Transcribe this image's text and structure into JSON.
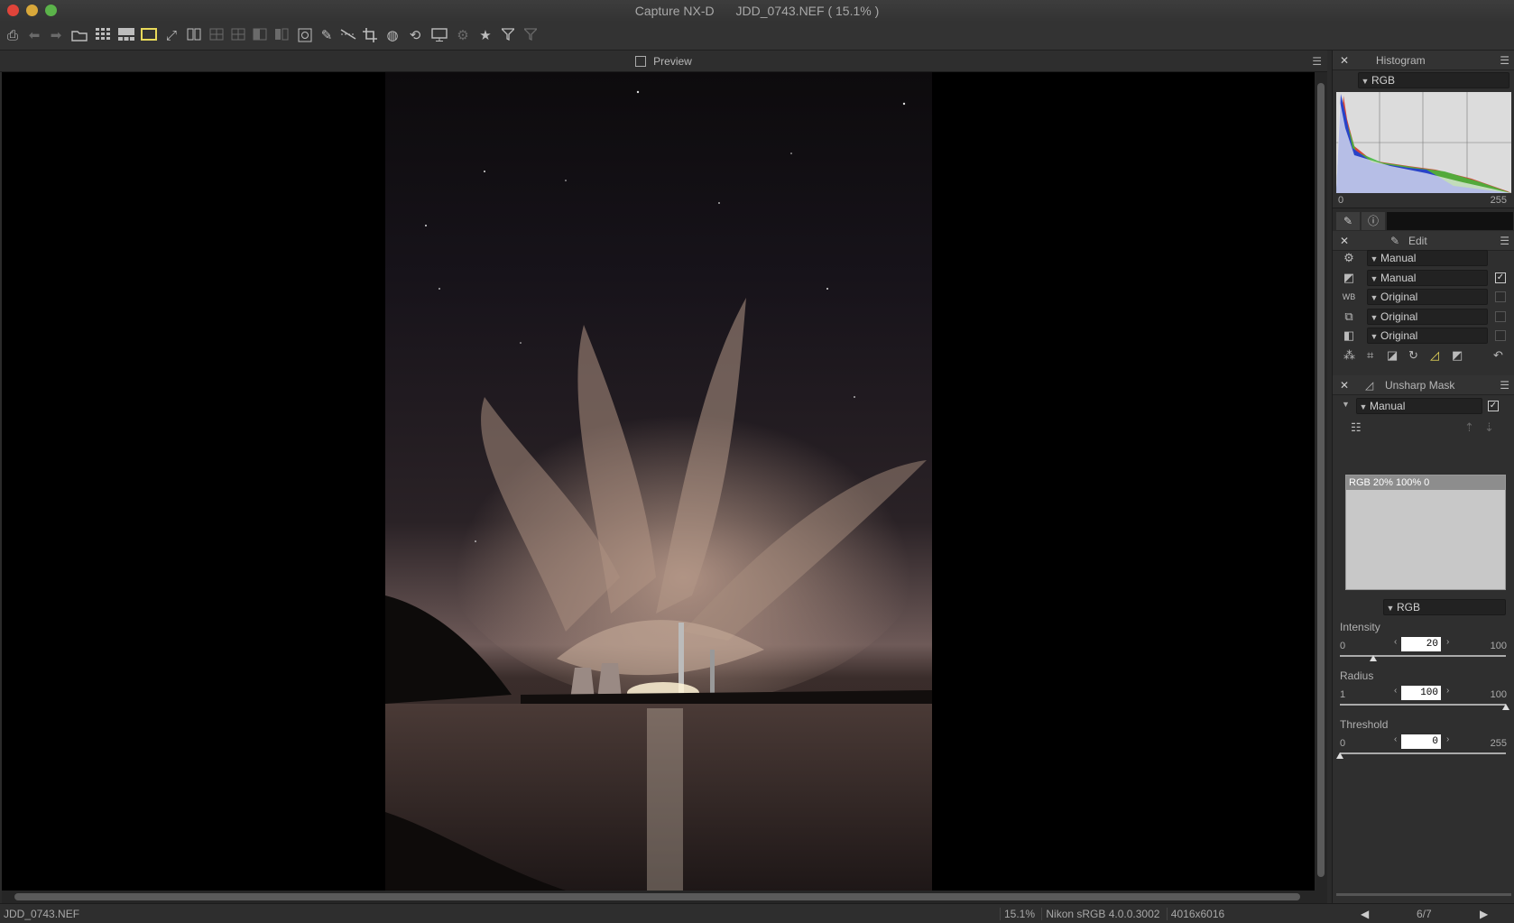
{
  "window": {
    "app_title": "Capture NX-D",
    "document_title": "JDD_0743.NEF ( 15.1% )"
  },
  "toolbar": {
    "icons": [
      "print-icon",
      "back-icon",
      "forward-icon",
      "open-folder-icon",
      "thumbnail-grid-icon",
      "filmstrip-icon",
      "single-view-icon",
      "fullscreen-icon",
      "compare-two-icon",
      "compare-four-icon",
      "compare-grid-icon",
      "compare-split-icon",
      "before-after-icon",
      "loupe-icon",
      "retouch-brush-icon",
      "straighten-icon",
      "crop-icon",
      "auto-retouch-icon",
      "rotate-icon",
      "monitor-icon",
      "gear-icon",
      "star-icon",
      "filter-icon",
      "filter-clear-icon"
    ]
  },
  "preview": {
    "header_label": "Preview"
  },
  "histogram": {
    "title": "Histogram",
    "channel": "RGB",
    "min_label": "0",
    "max_label": "255"
  },
  "edit": {
    "title": "Edit",
    "rows": [
      {
        "icon": "gear-icon",
        "value": "Manual",
        "checked": null
      },
      {
        "icon": "exposure-icon",
        "value": "Manual",
        "checked": true
      },
      {
        "icon": "white-balance-icon",
        "value": "Original",
        "checked": false
      },
      {
        "icon": "picture-control-icon",
        "value": "Original",
        "checked": false
      },
      {
        "icon": "tone-icon",
        "value": "Original",
        "checked": false
      }
    ]
  },
  "unsharp": {
    "title": "Unsharp Mask",
    "preset": "Manual",
    "enabled": true,
    "list_items": [
      "RGB 20% 100% 0"
    ],
    "channel": "RGB",
    "intensity": {
      "label": "Intensity",
      "value": "20",
      "min": "0",
      "max": "100",
      "fraction": 0.2
    },
    "radius": {
      "label": "Radius",
      "value": "100",
      "min": "1",
      "max": "100",
      "fraction": 1.0
    },
    "threshold": {
      "label": "Threshold",
      "value": "0",
      "min": "0",
      "max": "255",
      "fraction": 0.0
    }
  },
  "status": {
    "filename": "JDD_0743.NEF",
    "zoom": "15.1%",
    "color_profile": "Nikon sRGB 4.0.0.3002",
    "dimensions": "4016x6016",
    "page": "6/7"
  },
  "colors": {
    "accent_active": "#e8d95a",
    "histogram_bg": "#dcdcdc"
  }
}
